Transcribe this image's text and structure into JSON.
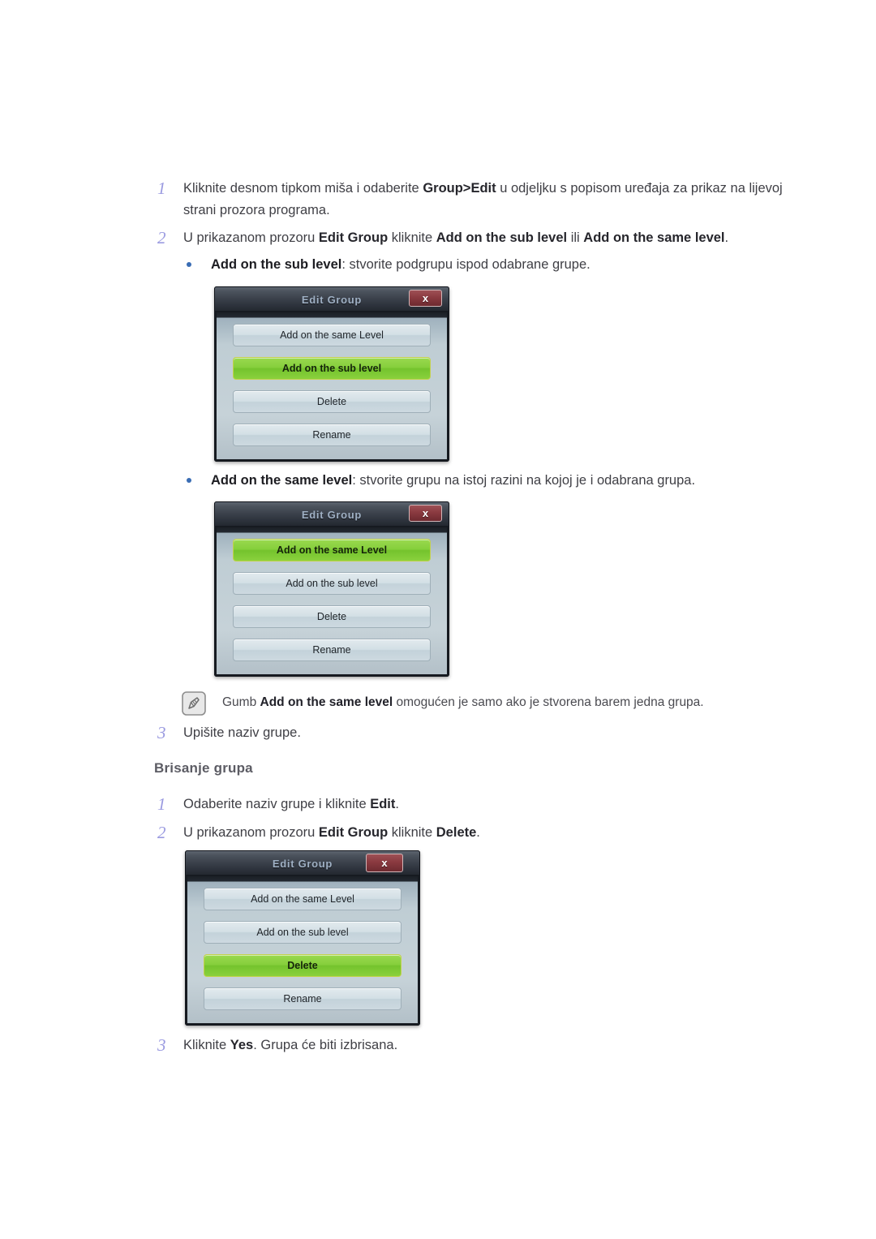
{
  "steps_create": [
    {
      "num": "1",
      "html": "Kliknite desnom tipkom miša i odaberite <b>Group&gt;Edit</b> u odjeljku s popisom uređaja za prikaz na lijevoj strani prozora programa."
    },
    {
      "num": "2",
      "html": "U prikazanom prozoru <b>Edit Group</b> kliknite <b>Add on the sub level</b> ili <b>Add on the same level</b>."
    },
    {
      "num": "3",
      "html": "Upišite naziv grupe."
    }
  ],
  "bullets": [
    {
      "html": "<b>Add on the sub level</b>: stvorite podgrupu ispod odabrane grupe."
    },
    {
      "html": "<b>Add on the same level</b>: stvorite grupu na istoj razini na kojoj je i odabrana grupa."
    }
  ],
  "note": {
    "icon": "note-pencil-icon",
    "html": "Gumb <b>Add on the same level</b> omogućen je samo ako je stvorena barem jedna grupa."
  },
  "section_heading": "Brisanje grupa",
  "steps_delete": [
    {
      "num": "1",
      "html": "Odaberite naziv grupe i kliknite <b>Edit</b>."
    },
    {
      "num": "2",
      "html": "U prikazanom prozoru <b>Edit Group</b> kliknite <b>Delete</b>."
    },
    {
      "num": "3",
      "html": "Kliknite <b>Yes</b>. Grupa će biti izbrisana."
    }
  ],
  "dialogs": [
    {
      "id": "dialog-sub-level",
      "title": "Edit Group",
      "close_label": "x",
      "buttons": [
        {
          "label": "Add on the same Level",
          "active": false
        },
        {
          "label": "Add on the sub level",
          "active": true
        },
        {
          "label": "Delete",
          "active": false
        },
        {
          "label": "Rename",
          "active": false
        }
      ]
    },
    {
      "id": "dialog-same-level",
      "title": "Edit Group",
      "close_label": "x",
      "buttons": [
        {
          "label": "Add on the same Level",
          "active": true
        },
        {
          "label": "Add on the sub level",
          "active": false
        },
        {
          "label": "Delete",
          "active": false
        },
        {
          "label": "Rename",
          "active": false
        }
      ]
    },
    {
      "id": "dialog-delete",
      "title": "Edit Group",
      "close_label": "x",
      "buttons": [
        {
          "label": "Add on the same Level",
          "active": false
        },
        {
          "label": "Add on the sub level",
          "active": false
        },
        {
          "label": "Delete",
          "active": true
        },
        {
          "label": "Rename",
          "active": false
        }
      ]
    }
  ],
  "colors": {
    "step_number": "#9a9ae0",
    "bullet": "#3a6db4",
    "heading": "#5c5c64",
    "body_text": "#3f3f45",
    "dialog_titlebar": "#343a44",
    "dialog_title_text": "#9fb0c4",
    "dialog_body": "#c6d2d8",
    "button_active_green": "#86cf3c",
    "close_button_red": "#8a3a40"
  }
}
